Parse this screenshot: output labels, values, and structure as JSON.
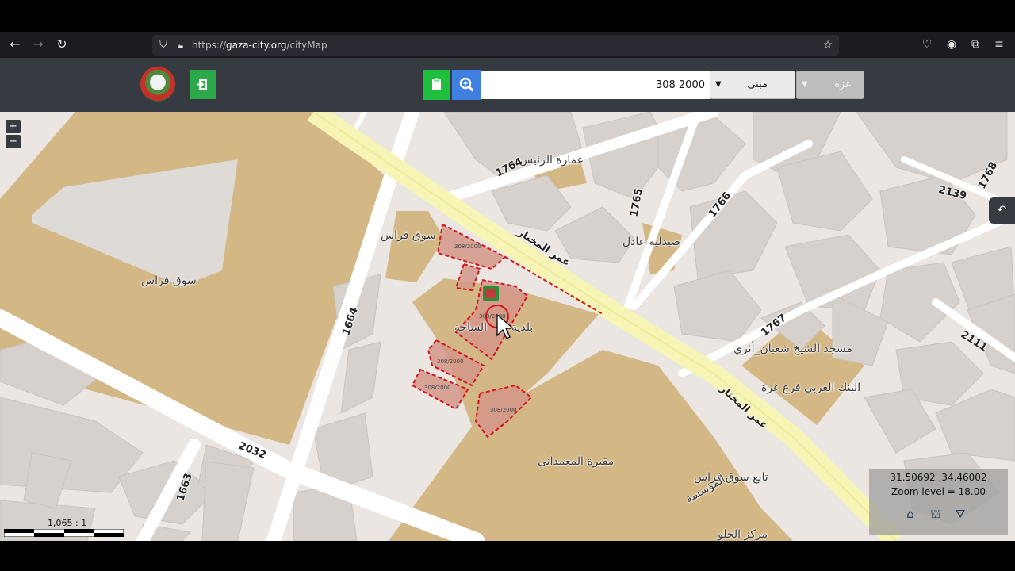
{
  "browser": {
    "url_scheme": "https://",
    "url_host": "gaza-city.org",
    "url_path": "/cityMap"
  },
  "header": {
    "search_value": "308 2000",
    "type_select": "مبنى",
    "city_select": "غزة"
  },
  "map": {
    "labels": {
      "souq_faras_1": "سوق فراس",
      "souq_faras_2": "سوق فراس",
      "omarat_raees": "عمارة الرئيس",
      "saydaliya_adel": "صيدلية عادل",
      "baladiya": "بلدية",
      "saha": "الساحة",
      "masjid": "مسجد الشيخ شعبان_أثري",
      "bank": "البنك العربي فرع غزة",
      "maqbara": "مقبرة المعمداني",
      "tabe_souq": "تابع سوق فراس",
      "mousasa": "المؤسسة",
      "markaz": "مركز الحلو",
      "omar_mukhtar_1": "عمر المختار",
      "omar_mukhtar_2": "عمر المختار"
    },
    "roads": {
      "r1764": "1764",
      "r1765": "1765",
      "r1766": "1766",
      "r1768": "1768",
      "r2139": "2139",
      "r1767": "1767",
      "r2111": "2111",
      "r1664": "1664",
      "r1663": "1663",
      "r2032": "2032"
    },
    "parcels": {
      "p1": "308/2000",
      "p2": "308/2000",
      "p3": "308/2000",
      "p4": "308/2000",
      "p5": "308/2000"
    },
    "scale": "1,065 : 1",
    "coords": "31.50692 ,34.46002",
    "zoom_level": "Zoom level = 18.00"
  }
}
